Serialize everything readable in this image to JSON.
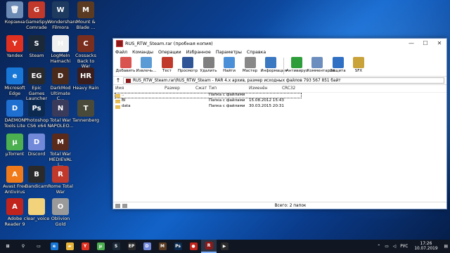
{
  "desktop": {
    "icons": [
      {
        "label": "Корзина",
        "color": "#6b8bb5",
        "glyph": "🗑"
      },
      {
        "label": "GameSpy Comrade",
        "color": "#c0392b",
        "glyph": "G"
      },
      {
        "label": "Wondershare Filmora",
        "color": "#1e3a5f",
        "glyph": "W"
      },
      {
        "label": "Mount & Blade ...",
        "color": "#5a3b22",
        "glyph": "M"
      },
      {
        "label": "Yandex",
        "color": "#e03020",
        "glyph": "Y"
      },
      {
        "label": "Steam",
        "color": "#1b2838",
        "glyph": "S"
      },
      {
        "label": "LogMeIn Hamachi",
        "color": "#f0f0f0",
        "glyph": "H"
      },
      {
        "label": "Cossacks Back to War",
        "color": "#7a2e1e",
        "glyph": "C"
      },
      {
        "label": "Microsoft Edge",
        "color": "#1877d6",
        "glyph": "e"
      },
      {
        "label": "Epic Games Launcher",
        "color": "#2a2a2a",
        "glyph": "EG"
      },
      {
        "label": "DarkMod Ultimate C...",
        "color": "#4a2a1a",
        "glyph": "D"
      },
      {
        "label": "Heavy Rain",
        "color": "#3a1e1e",
        "glyph": "HR"
      },
      {
        "label": "DAEMON Tools Lite",
        "color": "#1f6fd1",
        "glyph": "D"
      },
      {
        "label": "Photoshop CS6 x64",
        "color": "#0c2a4f",
        "glyph": "Ps"
      },
      {
        "label": "Total War NAPOLEO...",
        "color": "#3a3a5a",
        "glyph": "N"
      },
      {
        "label": "Tannenberg",
        "color": "#4a4a3a",
        "glyph": "T"
      },
      {
        "label": "µTorrent",
        "color": "#4caf50",
        "glyph": "µ"
      },
      {
        "label": "Discord",
        "color": "#7289da",
        "glyph": "D"
      },
      {
        "label": "Total War MEDIEVAL I...",
        "color": "#5a2a1a",
        "glyph": "M"
      },
      {
        "label": "Avast Free Antivirus",
        "color": "#f07a1a",
        "glyph": "A"
      },
      {
        "label": "Bandicam",
        "color": "#2a2a2a",
        "glyph": "B"
      },
      {
        "label": "Rome Total War",
        "color": "#c0392b",
        "glyph": "R"
      },
      {
        "label": "Adobe Reader 9",
        "color": "#c0241c",
        "glyph": "A"
      },
      {
        "label": "clear_voice",
        "color": "#f2d27a",
        "glyph": ""
      },
      {
        "label": "Oblivion Gold",
        "color": "#9a9a9a",
        "glyph": "O"
      }
    ]
  },
  "window": {
    "title": "RUS_RTW_Steam.rar (пробная копия)",
    "menu": [
      "Файл",
      "Команды",
      "Операции",
      "Избранное",
      "Параметры",
      "Справка"
    ],
    "toolbar": [
      {
        "label": "Добавить",
        "color": "#d9534f"
      },
      {
        "label": "Извлечь...",
        "color": "#5b9bd5"
      },
      {
        "label": "Тест",
        "color": "#c0392b"
      },
      {
        "label": "Просмотр",
        "color": "#2f5597"
      },
      {
        "label": "Удалить",
        "color": "#7f7f7f"
      },
      {
        "label": "Найти",
        "color": "#4a90d9"
      },
      {
        "label": "Мастер",
        "color": "#888888"
      },
      {
        "label": "Информация",
        "color": "#3a78c2"
      },
      {
        "label": "Антивирус",
        "color": "#2e9e3a"
      },
      {
        "label": "Комментарий",
        "color": "#6c8ebf"
      },
      {
        "label": "Защита",
        "color": "#2f6fc4"
      },
      {
        "label": "SFX",
        "color": "#c9a23a"
      }
    ],
    "address": "RUS_RTW_Steam.rar\\RUS_RTW_Steam - RAR 4.x архив, размер исходных файлов 793 567 851 байт",
    "columns": [
      "Имя",
      "Размер",
      "Сжат",
      "Тип",
      "Изменён",
      "CRC32"
    ],
    "rows": [
      {
        "name": "..",
        "size": "",
        "packed": "",
        "type": "Папка с файлами",
        "modified": "",
        "crc": ""
      },
      {
        "name": "BI",
        "size": "",
        "packed": "",
        "type": "Папка с файлами",
        "modified": "15.08.2012 15:43",
        "crc": ""
      },
      {
        "name": "data",
        "size": "",
        "packed": "",
        "type": "Папка с файлами",
        "modified": "30.03.2015 20:31",
        "crc": ""
      }
    ],
    "status": "Всего: 2 папок"
  },
  "taskbar": {
    "items": [
      {
        "name": "start-button",
        "glyph": "⊞",
        "color": "#101622"
      },
      {
        "name": "search-icon",
        "glyph": "⚲",
        "color": "#101622"
      },
      {
        "name": "task-view",
        "glyph": "▭",
        "color": "#101622"
      },
      {
        "name": "edge",
        "glyph": "e",
        "color": "#1877d6"
      },
      {
        "name": "explorer",
        "glyph": "▰",
        "color": "#e8b53a"
      },
      {
        "name": "yandex",
        "glyph": "Y",
        "color": "#e03020"
      },
      {
        "name": "utorrent",
        "glyph": "µ",
        "color": "#4caf50"
      },
      {
        "name": "steam",
        "glyph": "S",
        "color": "#1b2838"
      },
      {
        "name": "epic",
        "glyph": "EP",
        "color": "#2a2a2a"
      },
      {
        "name": "discord",
        "glyph": "D",
        "color": "#7289da"
      },
      {
        "name": "mount-blade",
        "glyph": "M",
        "color": "#5a3b22"
      },
      {
        "name": "photoshop",
        "glyph": "Ps",
        "color": "#0c2a4f"
      },
      {
        "name": "bandicam",
        "glyph": "●",
        "color": "#c0241c"
      },
      {
        "name": "winrar",
        "glyph": "R",
        "color": "#8b1a1a"
      },
      {
        "name": "media",
        "glyph": "▶",
        "color": "#2a2a2a"
      }
    ],
    "lang": "РУС",
    "time": "17:26",
    "date": "10.07.2019"
  }
}
